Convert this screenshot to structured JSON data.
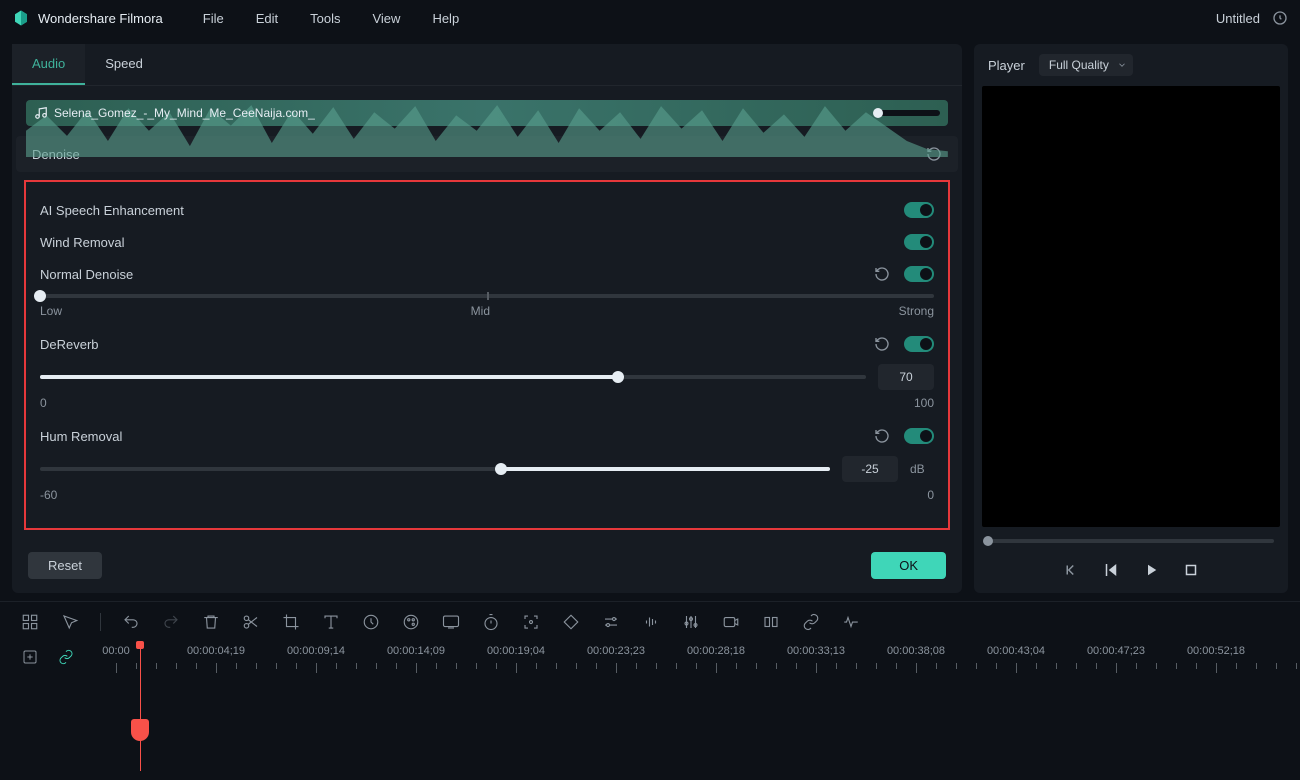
{
  "app": {
    "name": "Wondershare Filmora",
    "project": "Untitled"
  },
  "menu": {
    "file": "File",
    "edit": "Edit",
    "tools": "Tools",
    "view": "View",
    "help": "Help"
  },
  "tabs": {
    "audio": "Audio",
    "speed": "Speed"
  },
  "clip": {
    "filename": "Selena_Gomez_-_My_Mind_Me_CeeNaija.com_"
  },
  "section": {
    "denoise": "Denoise"
  },
  "options": {
    "ai_speech": {
      "label": "AI Speech Enhancement",
      "on": true
    },
    "wind": {
      "label": "Wind Removal",
      "on": true
    },
    "normal": {
      "label": "Normal Denoise",
      "on": true,
      "left": "Low",
      "mid": "Mid",
      "right": "Strong",
      "value": 0
    },
    "dereverb": {
      "label": "DeReverb",
      "on": true,
      "min": "0",
      "max": "100",
      "value": "70"
    },
    "hum": {
      "label": "Hum Removal",
      "on": true,
      "min": "-60",
      "max": "0",
      "value": "-25",
      "unit": "dB"
    }
  },
  "buttons": {
    "reset": "Reset",
    "ok": "OK"
  },
  "player": {
    "label": "Player",
    "quality": "Full Quality"
  },
  "timeline": {
    "times": [
      "00:00",
      "00:00:04;19",
      "00:00:09;14",
      "00:00:14;09",
      "00:00:19;04",
      "00:00:23;23",
      "00:00:28;18",
      "00:00:33;13",
      "00:00:38;08",
      "00:00:43;04",
      "00:00:47;23",
      "00:00:52;18"
    ]
  }
}
